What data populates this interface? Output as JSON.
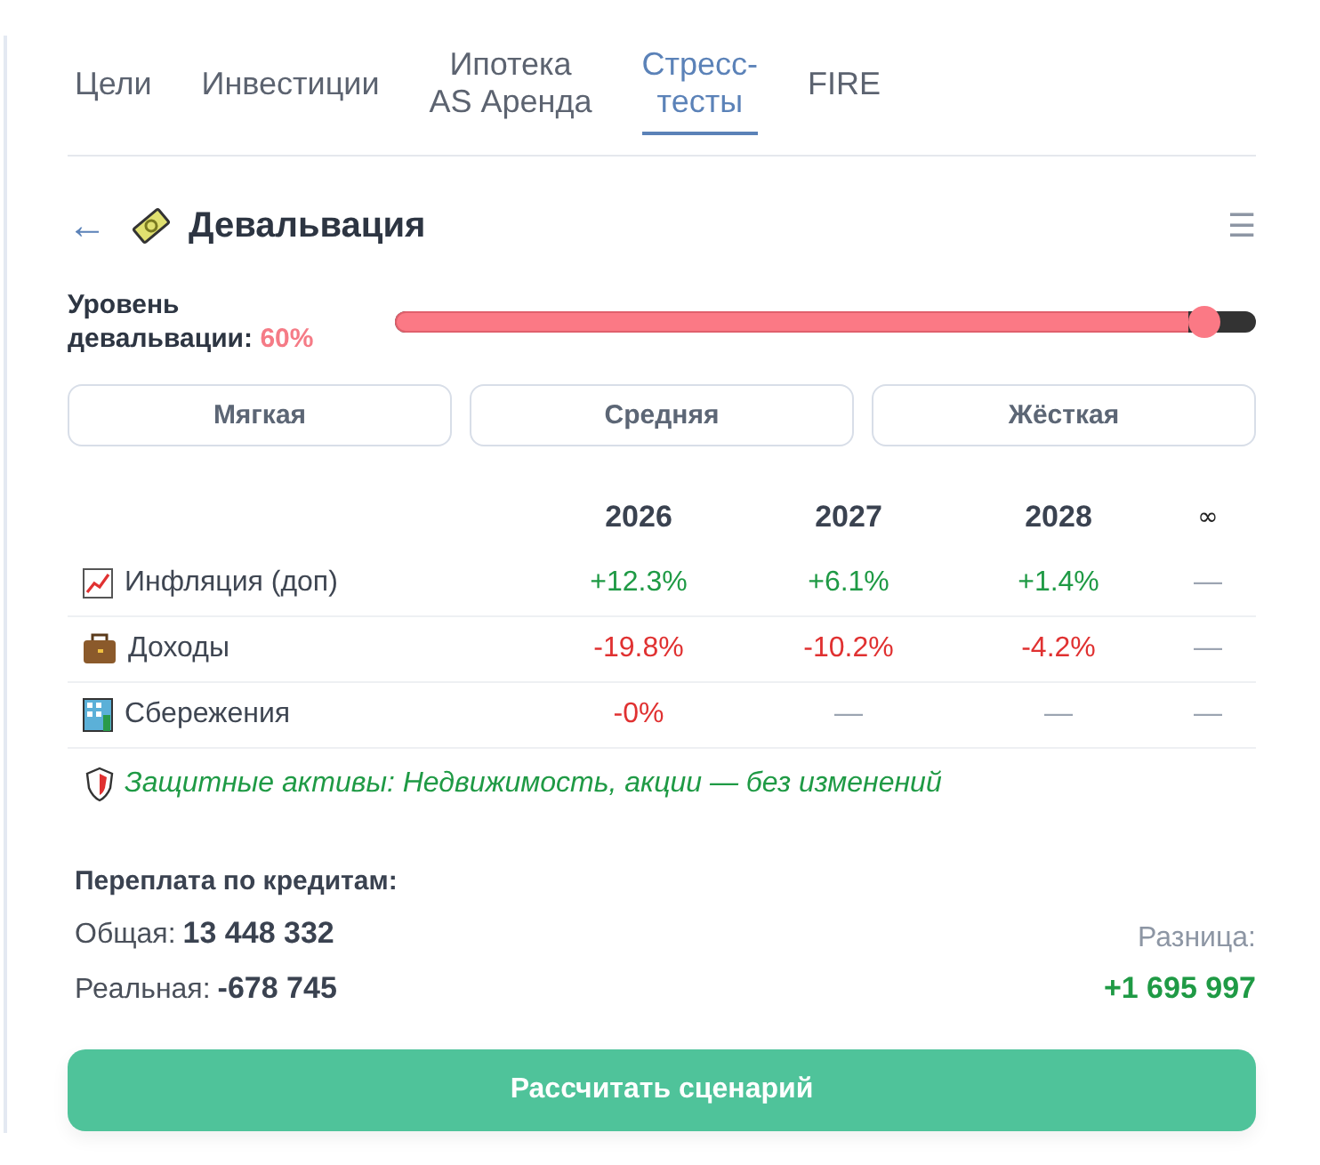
{
  "tabs": [
    {
      "label": "Цели",
      "selected": false
    },
    {
      "label": "Инвестиции",
      "selected": false
    },
    {
      "label": "Ипотека\nAS Аренда",
      "selected": false
    },
    {
      "label": "Стресс-\nтесты",
      "selected": true
    },
    {
      "label": "FIRE",
      "selected": false
    }
  ],
  "header": {
    "back": "←",
    "title": "Девальвация",
    "menu": "☰"
  },
  "slider": {
    "label": "Уровень\nдевальвации:",
    "value": "60%",
    "level": 0.94
  },
  "presets": [
    {
      "label": "Мягкая",
      "selected": false
    },
    {
      "label": "Средняя",
      "selected": false
    },
    {
      "label": "Жёсткая",
      "selected": false
    }
  ],
  "table": {
    "columns": [
      "2026",
      "2027",
      "2028",
      "∞"
    ],
    "rows": [
      {
        "label": "Инфляция (доп)",
        "cells": [
          {
            "text": "+12.3%",
            "kind": "up"
          },
          {
            "text": "+6.1%",
            "kind": "up"
          },
          {
            "text": "+1.4%",
            "kind": "up"
          },
          {
            "text": "—",
            "kind": "none"
          }
        ]
      },
      {
        "label": "Доходы",
        "cells": [
          {
            "text": "-19.8%",
            "kind": "down"
          },
          {
            "text": "-10.2%",
            "kind": "down"
          },
          {
            "text": "-4.2%",
            "kind": "down"
          },
          {
            "text": "—",
            "kind": "none"
          }
        ]
      },
      {
        "label": "Сбережения",
        "cells": [
          {
            "text": "-0%",
            "kind": "down"
          },
          {
            "text": "—",
            "kind": "none"
          },
          {
            "text": "—",
            "kind": "none"
          },
          {
            "text": "—",
            "kind": "none"
          }
        ]
      }
    ]
  },
  "note": "Защитные активы: Недвижимость, акции — без изменений",
  "overpay": {
    "title": "Переплата по кредитам:",
    "total_label": "Общая:",
    "total": "13 448 332",
    "real_label": "Реальная:",
    "real": "-678 745",
    "diff_label": "Разница:",
    "diff": "+1 695 997"
  },
  "action": "Рассчитать сценарий"
}
